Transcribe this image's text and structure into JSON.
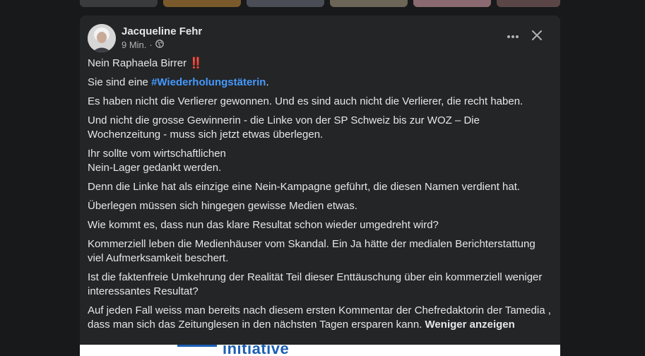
{
  "stories": [
    {
      "color": "#3a3b3c"
    },
    {
      "color": "#7a5a2a"
    },
    {
      "color": "#4a4d55"
    },
    {
      "color": "#6b6658"
    },
    {
      "color": "#8a6a70"
    },
    {
      "color": "#5a4646"
    }
  ],
  "post": {
    "author": "Jacqueline Fehr",
    "time": "9 Min.",
    "separator": "·",
    "audience_icon": "globe-icon",
    "line1_text": "Nein Raphaela Birrer ",
    "line1_emoji": "‼️",
    "line2_prefix": "Sie sind eine ",
    "line2_hashtag": "#Wiederholungstäterin",
    "line2_suffix": ".",
    "p3": "Es haben nicht die Verlierer gewonnen. Und es sind auch nicht die Verlierer, die recht haben.",
    "p4": "Und nicht die grosse Gewinnerin - die Linke von der SP Schweiz  bis zur WOZ – Die Wochenzeitung - muss sich jetzt etwas überlegen.",
    "p5_line1": "Ihr sollte vom wirtschaftlichen",
    "p5_line2": "Nein-Lager gedankt werden.",
    "p6": "Denn die Linke hat als einzige eine Nein-Kampagne geführt, die diesen Namen verdient hat.",
    "p7": "Überlegen müssen sich hingegen gewisse Medien etwas.",
    "p8": "Wie kommt es, dass nun das klare Resultat schon wieder umgedreht wird?",
    "p9": "Kommerziell leben die Medienhäuser vom Skandal. Ein Ja hätte der medialen Berichterstattung viel Aufmerksamkeit beschert.",
    "p10": "Ist die faktenfreie Umkehrung der Realität Teil dieser Enttäuschung über ein kommerziell weniger interessantes Resultat?",
    "p11": "Auf jeden Fall weiss man bereits nach diesem ersten Kommentar der Chefredaktorin der Tamedia , dass man sich das Zeitunglesen in den nächsten Tagen ersparen kann. ",
    "see_less": "Weniger anzeigen"
  },
  "attachment": {
    "visible_text": "initiative"
  }
}
